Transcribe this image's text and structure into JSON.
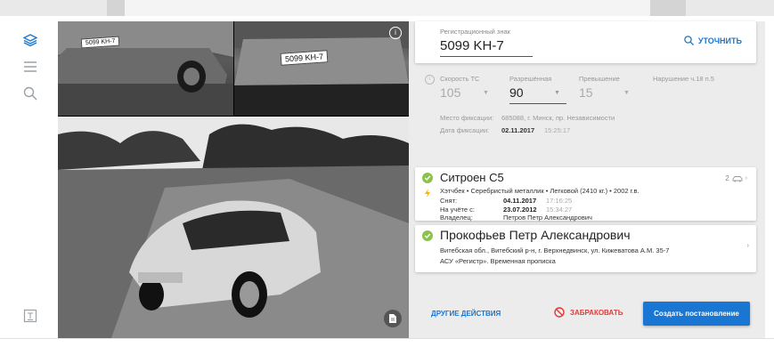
{
  "plate": {
    "label": "Регистрационный знак",
    "value": "5099 KH-7",
    "refine": "УТОЧНИТЬ"
  },
  "speed": {
    "speed_label": "Скорость ТС",
    "speed_value": "105",
    "allowed_label": "Разрешённая",
    "allowed_value": "90",
    "excess_label": "Превышение",
    "excess_value": "15",
    "violation_label": "Нарушение ч.18 п.5",
    "place_label": "Место фиксации:",
    "place_value": "685088, г. Минск, пр. Независимости",
    "date_label": "Дата фиксации:",
    "date_value": "02.11.2017",
    "time_value": "15:25:17"
  },
  "vehicle": {
    "title": "Ситроен С5",
    "count": "2",
    "desc": "Хэтчбек • Серебристый металлик • Легковой (2410 кг.) • 2002 г.в.",
    "removed_label": "Снят:",
    "removed_date": "04.11.2017",
    "removed_time": "17:16:25",
    "registered_label": "На учёте с:",
    "registered_date": "23.07.2012",
    "registered_time": "15:34:27",
    "owner_label": "Владелец:",
    "owner_value": "Петров Петр Александрович"
  },
  "person": {
    "name": "Прокофьев Петр Александрович",
    "address": "Витебская обл., Витебский р-н, г. Верхнедвинск, ул. Кижеватова А.М. 35-7",
    "registry": "АСУ «Регистр». Временная прописка"
  },
  "actions": {
    "other": "ДРУГИЕ ДЕЙСТВИЯ",
    "reject": "ЗАБРАКОВАТЬ",
    "create": "Создать постановление"
  },
  "photos": {
    "plate_left": "5099 KH-7",
    "plate_right": "5099 KH-7"
  },
  "colors": {
    "accent": "#1976d2",
    "success": "#8bc34a",
    "danger": "#e53935",
    "warning": "#ffb300"
  }
}
